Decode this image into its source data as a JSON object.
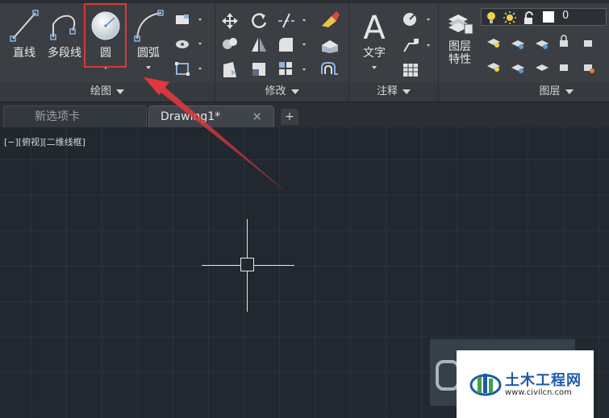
{
  "ribbon": {
    "panels": {
      "draw": {
        "title": "绘图"
      },
      "modify": {
        "title": "修改"
      },
      "annotation": {
        "title": "注释"
      },
      "layer": {
        "title": "图层"
      }
    },
    "draw_tools": {
      "line": "直线",
      "polyline": "多段线",
      "circle": "圆",
      "arc": "圆弧"
    },
    "annotation_tools": {
      "text": "文字"
    },
    "layer_tools": {
      "properties_line1": "图层",
      "properties_line2": "特性",
      "current_layer": "0"
    }
  },
  "tabs": {
    "items": [
      {
        "label": "新选项卡",
        "active": false
      },
      {
        "label": "Drawing1*",
        "active": true
      }
    ],
    "close_glyph": "✕",
    "new_glyph": "+"
  },
  "viewport": {
    "label": "[−][俯视][二维线框]"
  },
  "watermark": {
    "brand": "土木工程网",
    "url": "www.civilcn.com"
  },
  "colors": {
    "highlight": "#d9383c",
    "arrow": "#d9383c",
    "canvas_bg": "#212830",
    "ribbon_bg": "#3b3f44"
  }
}
